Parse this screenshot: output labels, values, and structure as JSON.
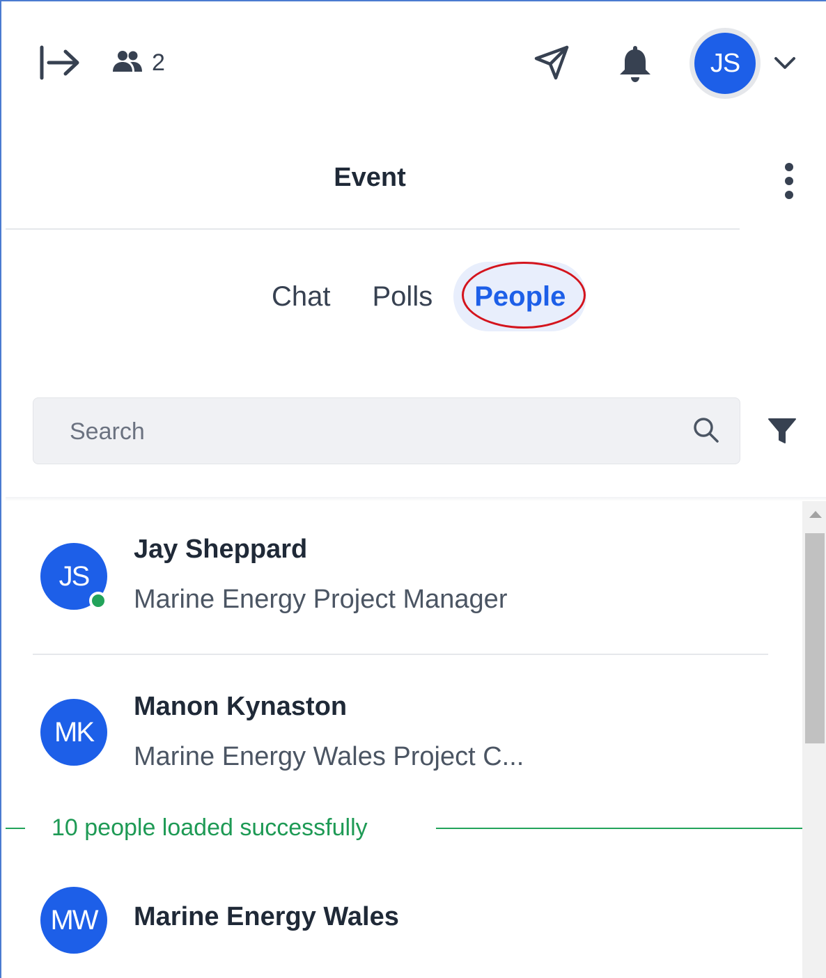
{
  "header": {
    "participant_count": "2",
    "user_initials": "JS"
  },
  "panel": {
    "title": "Event"
  },
  "tabs": [
    {
      "label": "Chat",
      "active": false
    },
    {
      "label": "Polls",
      "active": false
    },
    {
      "label": "People",
      "active": true
    }
  ],
  "search": {
    "placeholder": "Search",
    "value": ""
  },
  "people": [
    {
      "initials": "JS",
      "name": "Jay Sheppard",
      "role": "Marine Energy Project Manager",
      "online": true
    },
    {
      "initials": "MK",
      "name": "Manon Kynaston",
      "role": "Marine Energy Wales Project C...",
      "online": false
    },
    {
      "initials": "MW",
      "name": "Marine Energy Wales",
      "role": "",
      "online": false
    }
  ],
  "status_message": "10 people loaded successfully",
  "colors": {
    "accent": "#1d5fe8",
    "online": "#22a35a",
    "success_text": "#1e9a55",
    "highlight_outline": "#d4141d"
  },
  "icons": {
    "collapse": "collapse-panel-icon",
    "people": "people-icon",
    "send": "send-icon",
    "bell": "bell-icon",
    "chevron": "chevron-down-icon",
    "more": "more-vertical-icon",
    "search": "search-icon",
    "filter": "filter-icon"
  }
}
